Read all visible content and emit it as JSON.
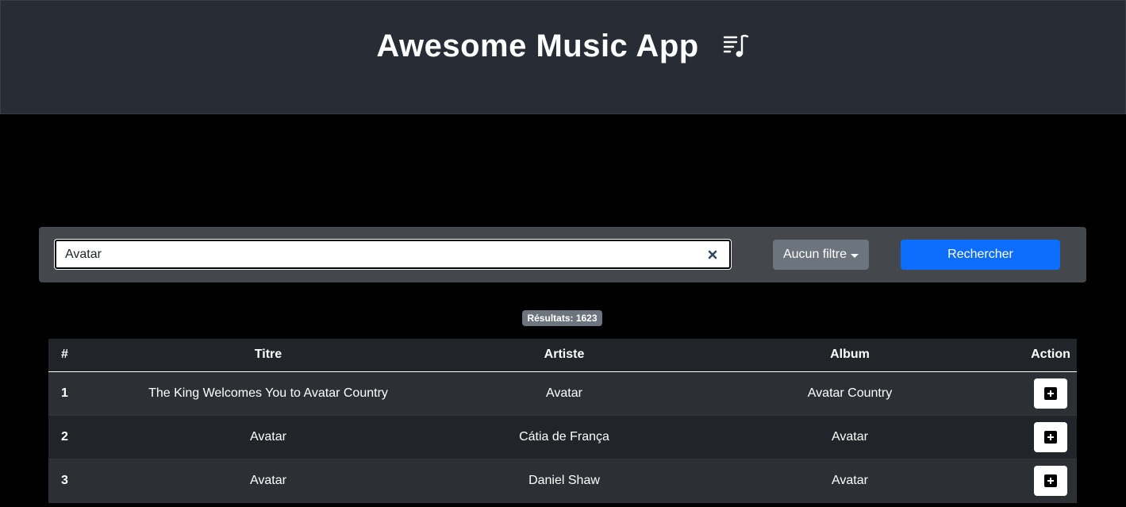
{
  "header": {
    "title": "Awesome Music App",
    "logo_icon": "music-playlist-icon"
  },
  "search": {
    "value": "Avatar",
    "clear_icon": "close-icon",
    "filter_label": "Aucun filtre",
    "submit_label": "Rechercher"
  },
  "results": {
    "badge": "Résultats: 1623"
  },
  "table": {
    "headers": [
      "#",
      "Titre",
      "Artiste",
      "Album",
      "Action"
    ],
    "rows": [
      {
        "num": "1",
        "title": "The King Welcomes You to Avatar Country",
        "artist": "Avatar",
        "album": "Avatar Country",
        "action_icon": "plus-square-icon"
      },
      {
        "num": "2",
        "title": "Avatar",
        "artist": "Cátia de França",
        "album": "Avatar",
        "action_icon": "plus-square-icon"
      },
      {
        "num": "3",
        "title": "Avatar",
        "artist": "Daniel Shaw",
        "album": "Avatar",
        "action_icon": "plus-square-icon"
      }
    ]
  },
  "colors": {
    "header_bg": "#282c34",
    "page_bg": "#000000",
    "primary": "#0d6efd",
    "secondary": "#6c757d",
    "table_dark": "#212529",
    "table_striped": "#2c3034"
  }
}
